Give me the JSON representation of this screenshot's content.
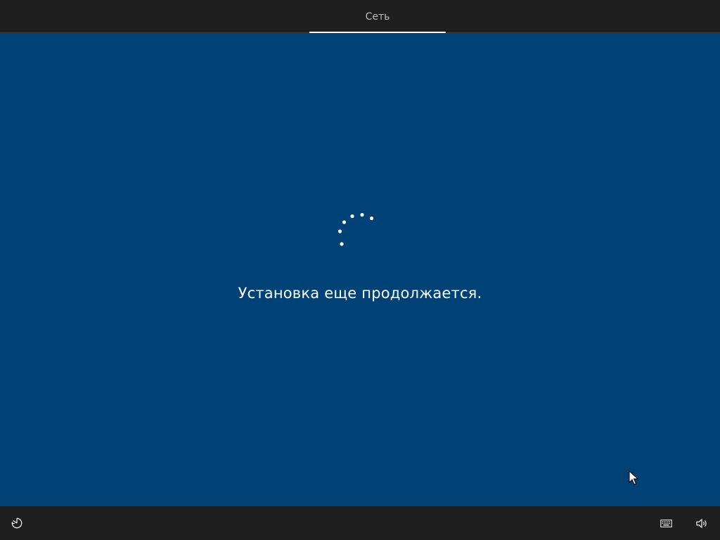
{
  "header": {
    "tabs": [
      {
        "label": "Сеть",
        "active": true
      }
    ]
  },
  "main": {
    "status_text": "Установка еще продолжается."
  },
  "footer": {
    "left_icons": [
      "ease-of-access-icon"
    ],
    "right_icons": [
      "keyboard-icon",
      "volume-icon"
    ]
  },
  "colors": {
    "background": "#004275",
    "bar": "#1f1f1f",
    "text": "#ffffff",
    "tab_text": "#bdbdbd"
  }
}
